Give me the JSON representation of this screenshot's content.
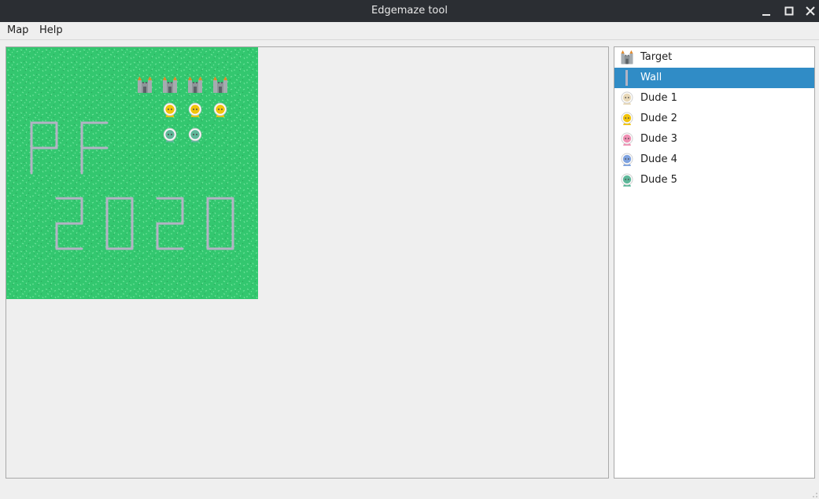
{
  "window": {
    "title": "Edgemaze tool"
  },
  "menu": {
    "items": [
      "Map",
      "Help"
    ]
  },
  "palette": {
    "items": [
      {
        "label": "Target",
        "icon": "castle-icon"
      },
      {
        "label": "Wall",
        "icon": "wall-icon",
        "selected": true
      },
      {
        "label": "Dude 1",
        "icon": "dude-icon",
        "color": "#e8d8b8"
      },
      {
        "label": "Dude 2",
        "icon": "dude-icon",
        "color": "#f2c40c"
      },
      {
        "label": "Dude 3",
        "icon": "dude-icon",
        "color": "#ef8fb3"
      },
      {
        "label": "Dude 4",
        "icon": "dude-icon",
        "color": "#7fa3e0"
      },
      {
        "label": "Dude 5",
        "icon": "dude-icon",
        "color": "#5fb89a"
      }
    ]
  },
  "colors": {
    "grass": "#33c76f",
    "selection": "#308cc6",
    "wall": "#b3b3c4"
  }
}
